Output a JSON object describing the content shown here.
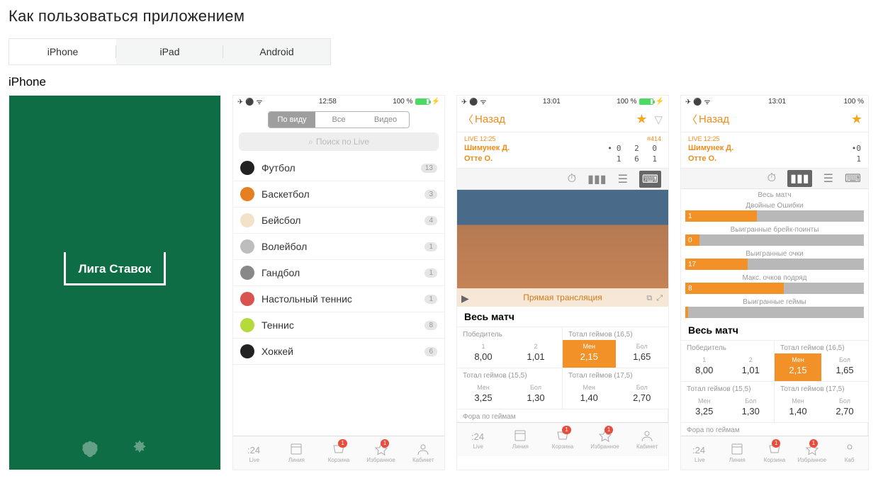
{
  "page_title": "Как пользоваться приложением",
  "tabs": [
    "iPhone",
    "iPad",
    "Android"
  ],
  "subtitle": "iPhone",
  "splash_logo": "Лига Ставок",
  "status2": {
    "time": "12:58",
    "batt": "100 %"
  },
  "status3": {
    "time": "13:01",
    "batt": "100 %"
  },
  "status4": {
    "time": "13:01",
    "batt": "100 %"
  },
  "seg": [
    "По виду",
    "Все",
    "Видео"
  ],
  "search_ph": "Поиск по Live",
  "sports": [
    {
      "name": "Футбол",
      "cnt": "13",
      "color": "#222"
    },
    {
      "name": "Баскетбол",
      "cnt": "3",
      "color": "#e67e22"
    },
    {
      "name": "Бейсбол",
      "cnt": "4",
      "color": "#f4e2c8"
    },
    {
      "name": "Волейбол",
      "cnt": "1",
      "color": "#bdbdbd"
    },
    {
      "name": "Гандбол",
      "cnt": "1",
      "color": "#888"
    },
    {
      "name": "Настольный теннис",
      "cnt": "1",
      "color": "#d9534f"
    },
    {
      "name": "Теннис",
      "cnt": "8",
      "color": "#b6d93b"
    },
    {
      "name": "Хоккей",
      "cnt": "6",
      "color": "#222"
    }
  ],
  "tabbar": [
    {
      "label": "Live",
      "badge": ""
    },
    {
      "label": "Линия",
      "badge": ""
    },
    {
      "label": "Корзина",
      "badge": "1"
    },
    {
      "label": "Избранное",
      "badge": "1"
    },
    {
      "label": "Кабинет",
      "badge": ""
    }
  ],
  "nav_back": "Назад",
  "live_tag": "LIVE 12:25",
  "match_id": "#414",
  "player1": "Шимунек Д.",
  "player2": "Отте О.",
  "score1": "0 2 0",
  "score2": "1 6 1",
  "video_label": "Прямая трансляция",
  "section_all": "Весь матч",
  "odds": {
    "winner_hd": "Победитель",
    "winner": [
      {
        "lab": "1",
        "val": "8,00"
      },
      {
        "lab": "2",
        "val": "1,01"
      }
    ],
    "tg165_hd": "Тотал геймов (16,5)",
    "tg165": [
      {
        "lab": "Мен",
        "val": "2,15",
        "hl": true
      },
      {
        "lab": "Бол",
        "val": "1,65"
      }
    ],
    "tg155_hd": "Тотал геймов (15,5)",
    "tg155": [
      {
        "lab": "Мен",
        "val": "3,25"
      },
      {
        "lab": "Бол",
        "val": "1,30"
      }
    ],
    "tg175_hd": "Тотал геймов (17,5)",
    "tg175": [
      {
        "lab": "Мен",
        "val": "1,40"
      },
      {
        "lab": "Бол",
        "val": "2,70"
      }
    ],
    "fora_hd": "Фора по геймам"
  },
  "stats": [
    {
      "label": "Весь матч",
      "l": "",
      "r": "",
      "lw": 0
    },
    {
      "label": "Двойные Ошибки",
      "l": "1",
      "r": "",
      "lw": 40
    },
    {
      "label": "Выигранные брейк-поинты",
      "l": "0",
      "r": "",
      "lw": 8
    },
    {
      "label": "Выигранные очки",
      "l": "17",
      "r": "",
      "lw": 35
    },
    {
      "label": "Макс. очков подряд",
      "l": "8",
      "r": "",
      "lw": 55
    },
    {
      "label": "Выигранные геймы",
      "l": "",
      "r": "",
      "lw": 0
    }
  ]
}
